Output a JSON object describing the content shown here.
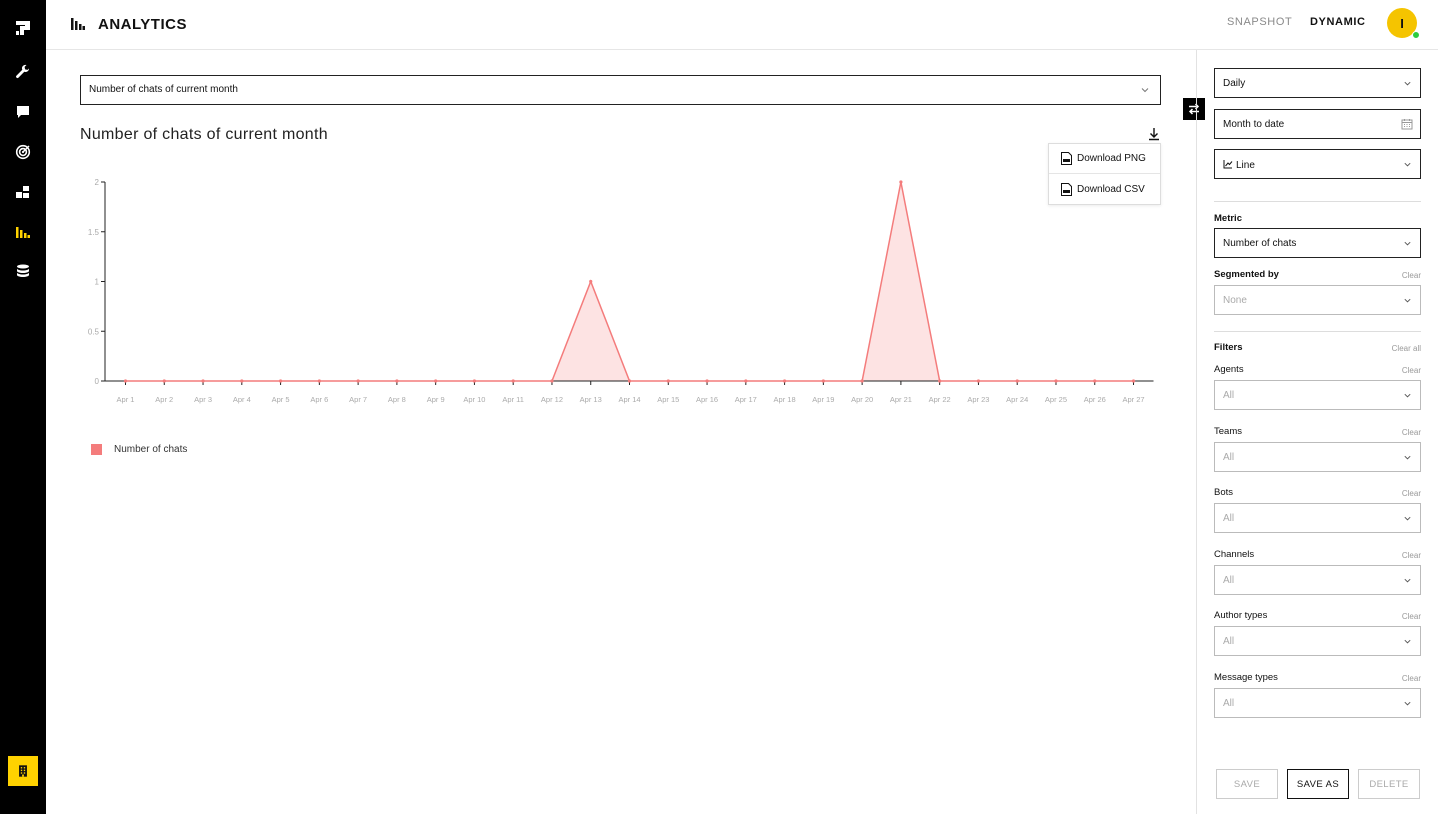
{
  "header": {
    "title": "ANALYTICS",
    "snapshot_tab": "SNAPSHOT",
    "dynamic_tab": "DYNAMIC",
    "avatar_initial": "I"
  },
  "main": {
    "report_select": "Number of chats of current month",
    "chart_title": "Number of chats of current month",
    "download": {
      "png": "Download PNG",
      "csv": "Download CSV"
    }
  },
  "chart_data": {
    "type": "area",
    "y_ticks": [
      "0",
      "0.5",
      "1",
      "1.5",
      "2"
    ],
    "ylim": [
      0,
      2
    ],
    "categories": [
      "Apr 1",
      "Apr 2",
      "Apr 3",
      "Apr 4",
      "Apr 5",
      "Apr 6",
      "Apr 7",
      "Apr 8",
      "Apr 9",
      "Apr 10",
      "Apr 11",
      "Apr 12",
      "Apr 13",
      "Apr 14",
      "Apr 15",
      "Apr 16",
      "Apr 17",
      "Apr 18",
      "Apr 19",
      "Apr 20",
      "Apr 21",
      "Apr 22",
      "Apr 23",
      "Apr 24",
      "Apr 25",
      "Apr 26",
      "Apr 27"
    ],
    "series": [
      {
        "name": "Number of chats",
        "values": [
          0,
          0,
          0,
          0,
          0,
          0,
          0,
          0,
          0,
          0,
          0,
          0,
          1,
          0,
          0,
          0,
          0,
          0,
          0,
          0,
          2,
          0,
          0,
          0,
          0,
          0,
          0
        ]
      }
    ],
    "legend": "bottom-left",
    "color": "#f47c7c"
  },
  "panel": {
    "interval": "Daily",
    "date_range": "Month to date",
    "chart_type": "Line",
    "metric_label": "Metric",
    "metric_value": "Number of chats",
    "segmented_label": "Segmented by",
    "segmented_value": "None",
    "clear": "Clear",
    "filters_label": "Filters",
    "clear_all": "Clear all",
    "filters": [
      {
        "label": "Agents",
        "value": "All"
      },
      {
        "label": "Teams",
        "value": "All"
      },
      {
        "label": "Bots",
        "value": "All"
      },
      {
        "label": "Channels",
        "value": "All"
      },
      {
        "label": "Author types",
        "value": "All"
      },
      {
        "label": "Message types",
        "value": "All"
      }
    ],
    "buttons": {
      "save": "SAVE",
      "save_as": "SAVE AS",
      "delete": "DELETE"
    }
  },
  "colors": {
    "accent": "#ffd200",
    "series": "#f47c7c",
    "status_online": "#2ecc40"
  }
}
